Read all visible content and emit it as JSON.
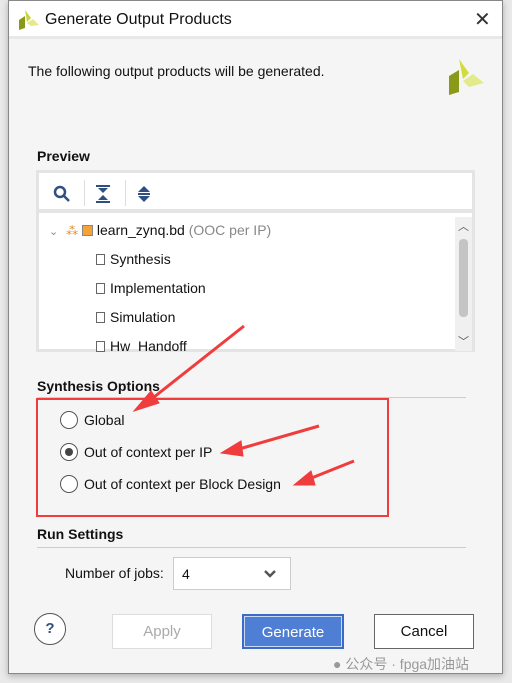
{
  "dialog": {
    "title": "Generate Output Products",
    "description": "The following output products will be generated.",
    "preview": {
      "heading": "Preview",
      "toolbar": [
        "search-icon",
        "collapse-all-icon",
        "expand-all-icon"
      ],
      "tree": {
        "root": {
          "label": "learn_zynq.bd",
          "suffix": "(OOC per IP)"
        },
        "children": [
          "Synthesis",
          "Implementation",
          "Simulation",
          "Hw_Handoff"
        ]
      }
    },
    "synthesis": {
      "heading": "Synthesis Options",
      "options": [
        {
          "label": "Global",
          "selected": false
        },
        {
          "label": "Out of context per IP",
          "selected": true
        },
        {
          "label": "Out of context per Block Design",
          "selected": false
        }
      ]
    },
    "run": {
      "heading": "Run Settings",
      "jobs_label": "Number of jobs:",
      "jobs_value": "4"
    },
    "buttons": {
      "help": "?",
      "apply": "Apply",
      "generate": "Generate",
      "cancel": "Cancel"
    }
  },
  "watermark": "公众号 · fpga加油站",
  "colors": {
    "annotation_red": "#f03c3c",
    "primary": "#4f7fd4",
    "logo_light": "#d6e04a",
    "logo_dark": "#8a9a18"
  }
}
